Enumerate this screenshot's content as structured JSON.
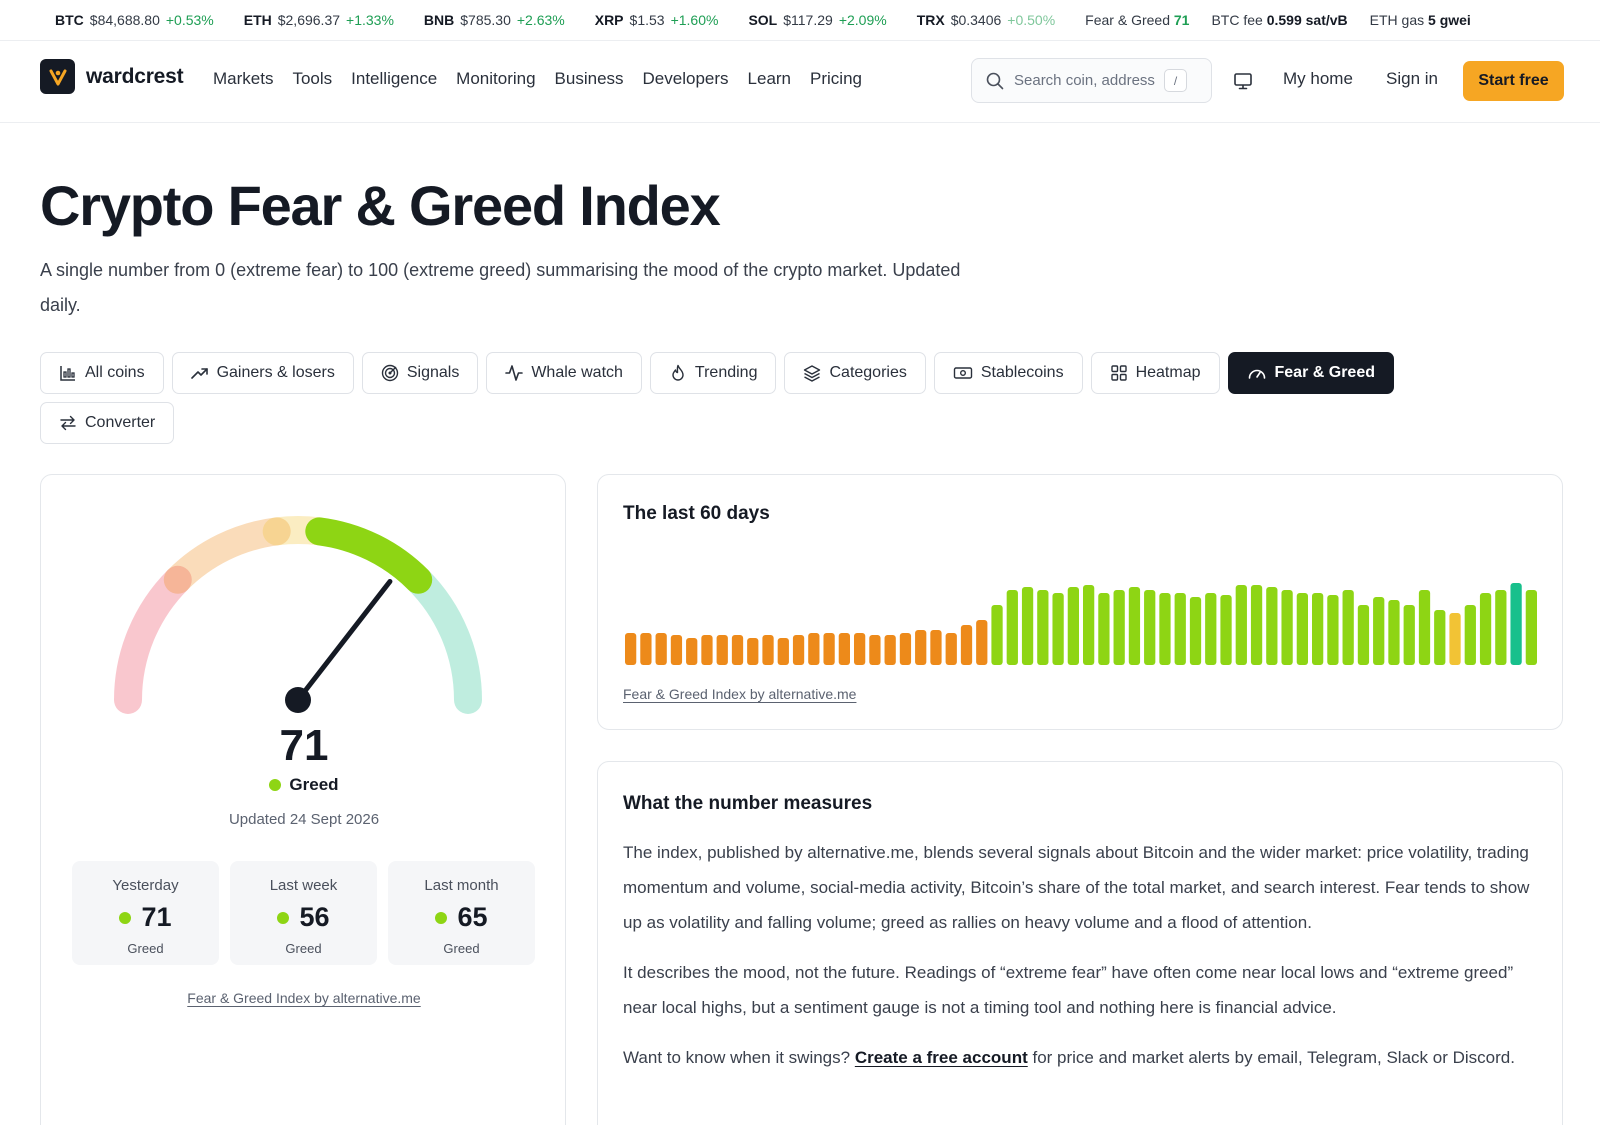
{
  "ticker": {
    "coins": [
      {
        "symbol": "BTC",
        "price": "$84,688.80",
        "change": "+0.53%"
      },
      {
        "symbol": "ETH",
        "price": "$2,696.37",
        "change": "+1.33%"
      },
      {
        "symbol": "BNB",
        "price": "$785.30",
        "change": "+2.63%"
      },
      {
        "symbol": "XRP",
        "price": "$1.53",
        "change": "+1.60%"
      },
      {
        "symbol": "SOL",
        "price": "$117.29",
        "change": "+2.09%"
      },
      {
        "symbol": "TRX",
        "price": "$0.3406",
        "change": "+0.50%"
      }
    ],
    "fear_greed_label": "Fear & Greed",
    "fear_greed_value": "71",
    "btc_fee_label": "BTC fee",
    "btc_fee_value": "0.599 sat/vB",
    "eth_gas_label": "ETH gas",
    "eth_gas_value": "5 gwei"
  },
  "nav": {
    "brand": "wardcrest",
    "menu": [
      "Markets",
      "Tools",
      "Intelligence",
      "Monitoring",
      "Business",
      "Developers",
      "Learn",
      "Pricing"
    ],
    "search_placeholder": "Search coin, address",
    "search_shortcut": "/",
    "my_home": "My home",
    "sign_in": "Sign in",
    "start_free": "Start free"
  },
  "hero": {
    "title": "Crypto Fear & Greed Index",
    "subtitle": "A single number from 0 (extreme fear) to 100 (extreme greed) summarising the mood of the crypto market. Updated daily."
  },
  "tabs": [
    {
      "label": "All coins",
      "icon": "bar-chart-icon"
    },
    {
      "label": "Gainers & losers",
      "icon": "trend-up-icon"
    },
    {
      "label": "Signals",
      "icon": "radar-icon"
    },
    {
      "label": "Whale watch",
      "icon": "pulse-icon"
    },
    {
      "label": "Trending",
      "icon": "flame-icon"
    },
    {
      "label": "Categories",
      "icon": "layers-icon"
    },
    {
      "label": "Stablecoins",
      "icon": "banknote-icon"
    },
    {
      "label": "Heatmap",
      "icon": "grid-icon"
    },
    {
      "label": "Fear & Greed",
      "icon": "gauge-icon",
      "active": true
    },
    {
      "label": "Converter",
      "icon": "swap-icon"
    }
  ],
  "gauge": {
    "value": 71,
    "value_text": "71",
    "classification": "Greed",
    "updated": "Updated 24 Sept 2026",
    "source": "Fear & Greed Index by alternative.me",
    "history": [
      {
        "label": "Yesterday",
        "value": "71",
        "classification": "Greed"
      },
      {
        "label": "Last week",
        "value": "56",
        "classification": "Greed"
      },
      {
        "label": "Last month",
        "value": "65",
        "classification": "Greed"
      }
    ]
  },
  "chart_data": {
    "type": "bar",
    "title": "The last 60 days",
    "xlabel": "",
    "ylabel": "",
    "ylim": [
      0,
      100
    ],
    "grid": false,
    "values": [
      32,
      32,
      32,
      30,
      27,
      30,
      30,
      30,
      27,
      30,
      27,
      30,
      32,
      32,
      32,
      32,
      30,
      30,
      32,
      35,
      35,
      32,
      40,
      45,
      60,
      75,
      78,
      75,
      72,
      78,
      80,
      72,
      75,
      78,
      75,
      72,
      72,
      68,
      72,
      70,
      80,
      80,
      78,
      75,
      72,
      72,
      70,
      75,
      60,
      68,
      65,
      60,
      75,
      55,
      52,
      60,
      72,
      75,
      82,
      75
    ]
  },
  "colors": {
    "extreme_fear": "#e8354f",
    "fear": "#ed8a1a",
    "neutral": "#f2c335",
    "greed": "#8ed514",
    "extreme_greed": "#18c08c",
    "accent": "#f6a623",
    "ink": "#151a24"
  },
  "article": {
    "title": "What the number measures",
    "p1": "The index, published by alternative.me, blends several signals about Bitcoin and the wider market: price volatility, trading momentum and volume, social-media activity, Bitcoin’s share of the total market, and search interest. Fear tends to show up as volatility and falling volume; greed as rallies on heavy volume and a flood of attention.",
    "p2": "It describes the mood, not the future. Readings of “extreme fear” have often come near local lows and “extreme greed” near local highs, but a sentiment gauge is not a timing tool and nothing here is financial advice.",
    "p3_before": "Want to know when it swings?",
    "p3_link": "Create a free account",
    "p3_after": "for price and market alerts by email, Telegram, Slack or Discord."
  }
}
